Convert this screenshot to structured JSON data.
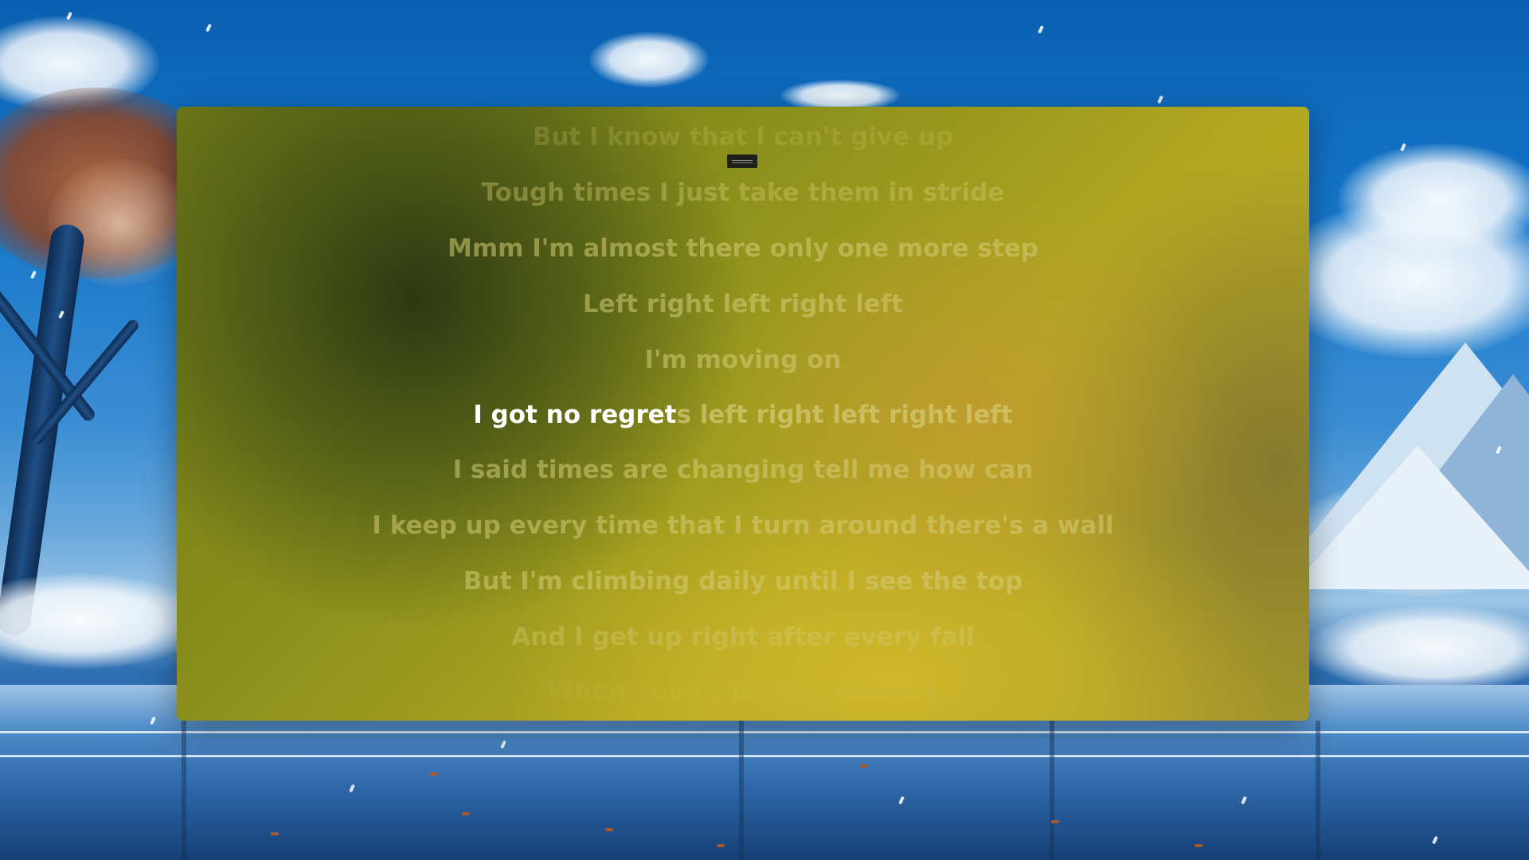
{
  "lyrics": {
    "lines": [
      "But I know that I can't give up",
      "Tough times I just take them in stride",
      "Mmm I'm almost there only one more step",
      "Left right left right left",
      "I'm moving on",
      "I said times are changing tell me how can",
      "I keep up every time that I turn around there's a wall",
      "But I'm climbing daily until I see the top",
      "And I get up right after every fall",
      "When you're feeling down it"
    ],
    "current_sung": "I got no regret",
    "current_unsung": "s left right left right left"
  },
  "colors": {
    "sung_text": "#ffffff",
    "accent": "#b5a922"
  },
  "icons": {
    "drag_handle": "drag-handle-icon"
  }
}
